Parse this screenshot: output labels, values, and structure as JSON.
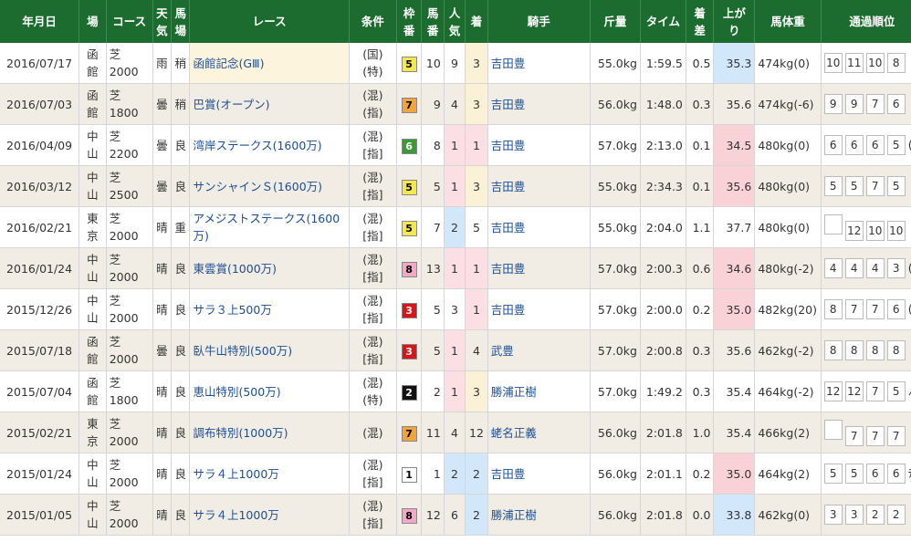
{
  "headers": [
    "年月日",
    "場",
    "コース",
    "天気",
    "馬場",
    "レース",
    "条件",
    "枠番",
    "馬番",
    "人気",
    "着",
    "騎手",
    "斤量",
    "タイム",
    "着差",
    "上がり",
    "馬体重",
    "通過順位"
  ],
  "header_split": {
    "weather": [
      "天",
      "気"
    ],
    "track": [
      "馬",
      "場"
    ],
    "waku": [
      "枠",
      "番"
    ],
    "umaban": [
      "馬",
      "番"
    ],
    "ninki": [
      "人",
      "気"
    ],
    "chakusa": [
      "着",
      "差"
    ],
    "agari": [
      "上が",
      "り"
    ]
  },
  "rows": [
    {
      "date": "2016/07/17",
      "place": [
        "函",
        "館"
      ],
      "course": [
        "芝",
        "2000"
      ],
      "weather": "雨",
      "track": "稍",
      "race": "函館記念(GⅢ)",
      "grade": true,
      "cond": [
        "(国)",
        "(特)"
      ],
      "waku": "5",
      "waku_bg": "#f4e84a",
      "waku_fg": "#000000",
      "umaban": "10",
      "ninki": "9",
      "ninki_hl": "",
      "chaku": "3",
      "chaku_hl": "yellow",
      "jockey": "吉田豊",
      "weight": "55.0kg",
      "time": "1:59.5",
      "diff": "0.5",
      "agari": "35.3",
      "agari_hl": "agari-blue",
      "bw": "474kg(0)",
      "pass": [
        "10",
        "11",
        "10",
        "8"
      ],
      "spill": ""
    },
    {
      "date": "2016/07/03",
      "place": [
        "函",
        "館"
      ],
      "course": [
        "芝",
        "1800"
      ],
      "weather": "曇",
      "track": "稍",
      "race": "巴賞(オープン)",
      "grade": false,
      "cond": [
        "(混)",
        "(指)"
      ],
      "waku": "7",
      "waku_bg": "#f2a43c",
      "waku_fg": "#000000",
      "umaban": "9",
      "ninki": "4",
      "ninki_hl": "",
      "chaku": "3",
      "chaku_hl": "yellow",
      "jockey": "吉田豊",
      "weight": "56.0kg",
      "time": "1:48.0",
      "diff": "0.3",
      "agari": "35.6",
      "agari_hl": "",
      "bw": "474kg(-6)",
      "pass": [
        "9",
        "9",
        "7",
        "6"
      ],
      "spill": ""
    },
    {
      "date": "2016/04/09",
      "place": [
        "中",
        "山"
      ],
      "course": [
        "芝",
        "2200"
      ],
      "weather": "曇",
      "track": "良",
      "race": "湾岸ステークス(1600万)",
      "grade": false,
      "cond": [
        "(混)",
        "[指]"
      ],
      "waku": "6",
      "waku_bg": "#3a9a35",
      "waku_fg": "#ffffff",
      "umaban": "8",
      "ninki": "1",
      "ninki_hl": "pink",
      "chaku": "1",
      "chaku_hl": "pink",
      "jockey": "吉田豊",
      "weight": "57.0kg",
      "time": "2:13.0",
      "diff": "0.1",
      "agari": "34.5",
      "agari_hl": "agari-red",
      "bw": "480kg(0)",
      "pass": [
        "6",
        "6",
        "6",
        "5"
      ],
      "spill": "("
    },
    {
      "date": "2016/03/12",
      "place": [
        "中",
        "山"
      ],
      "course": [
        "芝",
        "2500"
      ],
      "weather": "曇",
      "track": "良",
      "race": "サンシャインＳ(1600万)",
      "grade": false,
      "cond": [
        "(混)",
        "[指]"
      ],
      "waku": "5",
      "waku_bg": "#f4e84a",
      "waku_fg": "#000000",
      "umaban": "5",
      "ninki": "1",
      "ninki_hl": "pink",
      "chaku": "3",
      "chaku_hl": "yellow",
      "jockey": "吉田豊",
      "weight": "55.0kg",
      "time": "2:34.3",
      "diff": "0.1",
      "agari": "35.6",
      "agari_hl": "agari-red",
      "bw": "480kg(0)",
      "pass": [
        "5",
        "5",
        "7",
        "5"
      ],
      "spill": ""
    },
    {
      "date": "2016/02/21",
      "place": [
        "東",
        "京"
      ],
      "course": [
        "芝",
        "2000"
      ],
      "weather": "晴",
      "track": "重",
      "race": "アメジストステークス(1600万)",
      "grade": false,
      "cond": [
        "(混)",
        "[指]"
      ],
      "waku": "5",
      "waku_bg": "#f4e84a",
      "waku_fg": "#000000",
      "umaban": "7",
      "ninki": "2",
      "ninki_hl": "blue",
      "chaku": "5",
      "chaku_hl": "",
      "jockey": "吉田豊",
      "weight": "55.0kg",
      "time": "2:04.0",
      "diff": "1.1",
      "agari": "37.7",
      "agari_hl": "",
      "bw": "480kg(0)",
      "pass": [
        "",
        "12",
        "10",
        "10"
      ],
      "spill": ""
    },
    {
      "date": "2016/01/24",
      "place": [
        "中",
        "山"
      ],
      "course": [
        "芝",
        "2000"
      ],
      "weather": "晴",
      "track": "良",
      "race": "東雲賞(1000万)",
      "grade": false,
      "cond": [
        "(混)",
        "[指]"
      ],
      "waku": "8",
      "waku_bg": "#f2a8c6",
      "waku_fg": "#000000",
      "umaban": "13",
      "ninki": "1",
      "ninki_hl": "pink",
      "chaku": "1",
      "chaku_hl": "pink",
      "jockey": "吉田豊",
      "weight": "57.0kg",
      "time": "2:00.3",
      "diff": "0.6",
      "agari": "34.6",
      "agari_hl": "agari-red",
      "bw": "480kg(-2)",
      "pass": [
        "4",
        "4",
        "4",
        "3"
      ],
      "spill": "("
    },
    {
      "date": "2015/12/26",
      "place": [
        "中",
        "山"
      ],
      "course": [
        "芝",
        "2000"
      ],
      "weather": "晴",
      "track": "良",
      "race": "サラ３上500万",
      "grade": false,
      "cond": [
        "(混)",
        "[指]"
      ],
      "waku": "3",
      "waku_bg": "#d8151b",
      "waku_fg": "#ffffff",
      "umaban": "5",
      "ninki": "3",
      "ninki_hl": "",
      "chaku": "1",
      "chaku_hl": "pink",
      "jockey": "吉田豊",
      "weight": "57.0kg",
      "time": "2:00.0",
      "diff": "0.2",
      "agari": "35.0",
      "agari_hl": "agari-red",
      "bw": "482kg(20)",
      "pass": [
        "8",
        "7",
        "7",
        "6"
      ],
      "spill": "("
    },
    {
      "date": "2015/07/18",
      "place": [
        "函",
        "館"
      ],
      "course": [
        "芝",
        "2000"
      ],
      "weather": "曇",
      "track": "良",
      "race": "臥牛山特別(500万)",
      "grade": false,
      "cond": [
        "(混)",
        "[指]"
      ],
      "waku": "3",
      "waku_bg": "#d8151b",
      "waku_fg": "#ffffff",
      "umaban": "5",
      "ninki": "1",
      "ninki_hl": "pink",
      "chaku": "4",
      "chaku_hl": "",
      "jockey": "武豊",
      "weight": "57.0kg",
      "time": "2:00.8",
      "diff": "0.3",
      "agari": "35.6",
      "agari_hl": "",
      "bw": "462kg(-2)",
      "pass": [
        "8",
        "8",
        "8",
        "8"
      ],
      "spill": ""
    },
    {
      "date": "2015/07/04",
      "place": [
        "函",
        "館"
      ],
      "course": [
        "芝",
        "1800"
      ],
      "weather": "晴",
      "track": "良",
      "race": "恵山特別(500万)",
      "grade": false,
      "cond": [
        "(混)",
        "(特)"
      ],
      "waku": "2",
      "waku_bg": "#111111",
      "waku_fg": "#ffffff",
      "umaban": "2",
      "ninki": "1",
      "ninki_hl": "pink",
      "chaku": "3",
      "chaku_hl": "yellow",
      "jockey": "勝浦正樹",
      "weight": "57.0kg",
      "time": "1:49.2",
      "diff": "0.3",
      "agari": "35.4",
      "agari_hl": "",
      "bw": "464kg(-2)",
      "pass": [
        "12",
        "12",
        "7",
        "5"
      ],
      "spill": "ﾉ"
    },
    {
      "date": "2015/02/21",
      "place": [
        "東",
        "京"
      ],
      "course": [
        "芝",
        "2000"
      ],
      "weather": "晴",
      "track": "良",
      "race": "調布特別(1000万)",
      "grade": false,
      "cond": [
        "(混)",
        ""
      ],
      "waku": "7",
      "waku_bg": "#f2a43c",
      "waku_fg": "#000000",
      "umaban": "11",
      "ninki": "4",
      "ninki_hl": "",
      "chaku": "12",
      "chaku_hl": "",
      "jockey": "蛯名正義",
      "weight": "56.0kg",
      "time": "2:01.8",
      "diff": "1.0",
      "agari": "35.4",
      "agari_hl": "",
      "bw": "466kg(2)",
      "pass": [
        "",
        "7",
        "7",
        "7"
      ],
      "spill": ""
    },
    {
      "date": "2015/01/24",
      "place": [
        "中",
        "山"
      ],
      "course": [
        "芝",
        "2000"
      ],
      "weather": "晴",
      "track": "良",
      "race": "サラ４上1000万",
      "grade": false,
      "cond": [
        "(混)",
        "[指]"
      ],
      "waku": "1",
      "waku_bg": "#ffffff",
      "waku_fg": "#000000",
      "umaban": "1",
      "ninki": "2",
      "ninki_hl": "blue",
      "chaku": "2",
      "chaku_hl": "blue",
      "jockey": "吉田豊",
      "weight": "56.0kg",
      "time": "2:01.1",
      "diff": "0.2",
      "agari": "35.0",
      "agari_hl": "agari-red",
      "bw": "464kg(2)",
      "pass": [
        "5",
        "5",
        "6",
        "6"
      ],
      "spill": "ﾃ"
    },
    {
      "date": "2015/01/05",
      "place": [
        "中",
        "山"
      ],
      "course": [
        "芝",
        "2000"
      ],
      "weather": "晴",
      "track": "良",
      "race": "サラ４上1000万",
      "grade": false,
      "cond": [
        "(混)",
        "[指]"
      ],
      "waku": "8",
      "waku_bg": "#f2a8c6",
      "waku_fg": "#000000",
      "umaban": "12",
      "ninki": "6",
      "ninki_hl": "",
      "chaku": "2",
      "chaku_hl": "blue",
      "jockey": "勝浦正樹",
      "weight": "56.0kg",
      "time": "2:01.8",
      "diff": "0.0",
      "agari": "33.8",
      "agari_hl": "agari-blue",
      "bw": "462kg(0)",
      "pass": [
        "3",
        "3",
        "2",
        "2"
      ],
      "spill": ""
    }
  ]
}
